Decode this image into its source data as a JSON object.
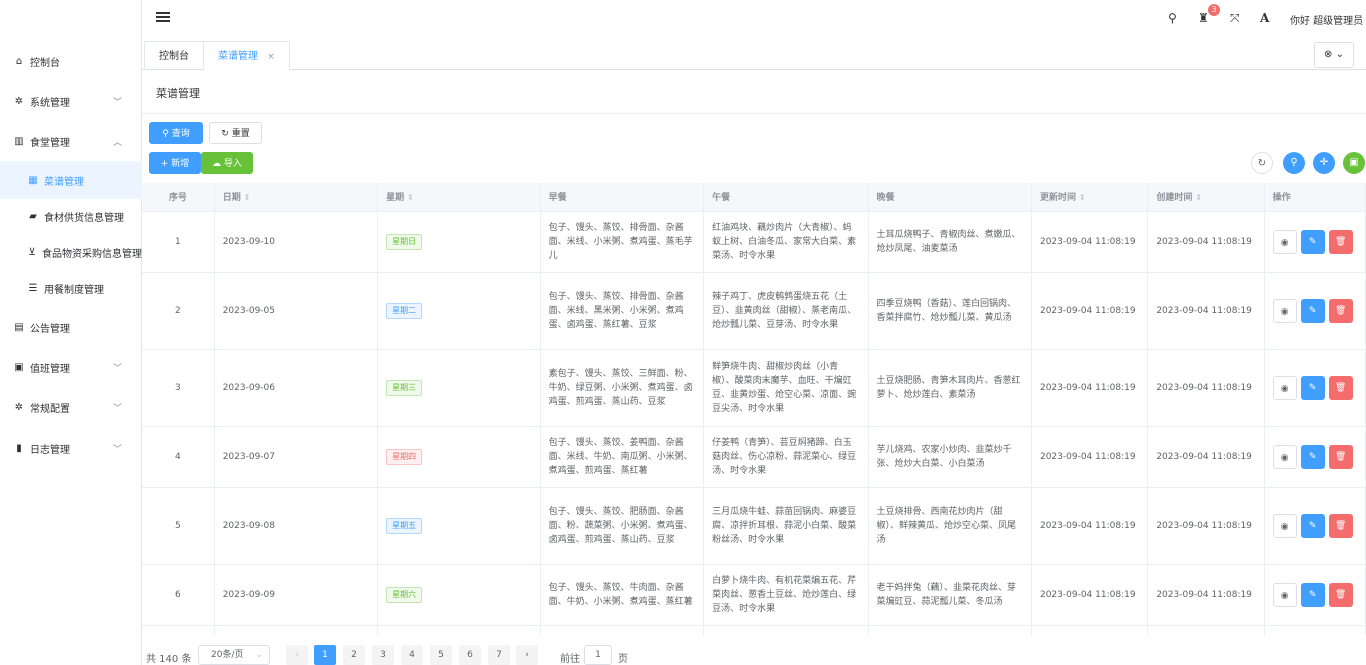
{
  "sidebar": {
    "items": [
      {
        "label": "控制台",
        "icon": "home-icon",
        "glyph": "🏠"
      },
      {
        "label": "系统管理",
        "icon": "gear-icon",
        "glyph": "⚙",
        "arrow": "﹀"
      },
      {
        "label": "食堂管理",
        "icon": "bank-icon",
        "glyph": "🏛",
        "arrow": "︿"
      },
      {
        "label": "菜谱管理",
        "icon": "calendar-icon",
        "glyph": "📅"
      },
      {
        "label": "食材供货信息管理",
        "icon": "truck-icon",
        "glyph": "🚚"
      },
      {
        "label": "食品物资采购信息管理",
        "icon": "cart-icon",
        "glyph": "🛒"
      },
      {
        "label": "用餐制度管理",
        "icon": "list-icon",
        "glyph": "☰"
      },
      {
        "label": "公告管理",
        "icon": "notice-icon",
        "glyph": "▦"
      },
      {
        "label": "值班管理",
        "icon": "id-card-icon",
        "glyph": "▣",
        "arrow": "﹀"
      },
      {
        "label": "常规配置",
        "icon": "cogs-icon",
        "glyph": "⚙",
        "arrow": "﹀"
      },
      {
        "label": "日志管理",
        "icon": "book-icon",
        "glyph": "▤",
        "arrow": "﹀"
      }
    ]
  },
  "header": {
    "notification_count": "3",
    "greeting": "你好 超级管理员",
    "font_glyph": "A"
  },
  "tabs": {
    "items": [
      {
        "label": "控制台"
      },
      {
        "label": "菜谱管理",
        "close": "×"
      }
    ],
    "close_all": "⊗ ⌄"
  },
  "page": {
    "title": "菜谱管理",
    "query_label": "查询",
    "reset_label": "重置",
    "add_label": "新增",
    "import_label": "导入"
  },
  "table": {
    "headers": [
      "序号",
      "日期",
      "星期",
      "早餐",
      "午餐",
      "晚餐",
      "更新时间",
      "创建时间",
      "操作"
    ],
    "rows": [
      {
        "no": "1",
        "date": "2023-09-10",
        "weekday": "星期日",
        "tag": "success",
        "breakfast": "包子、馒头、蒸饺、排骨面、杂酱面、米线、小米粥、煮鸡蛋、蒸毛芋儿",
        "lunch": "红油鸡块、藕炒肉片（大青椒）、蚂蚁上树、白油冬瓜、家常大白菜、素菜汤、时令水果",
        "dinner": "土耳瓜烧鸭子、青椒肉丝、煮嫩瓜、炝炒凤尾、油麦菜汤",
        "updated": "2023-09-04 11:08:19",
        "created": "2023-09-04 11:08:19"
      },
      {
        "no": "2",
        "date": "2023-09-05",
        "weekday": "星期二",
        "tag": "primary",
        "breakfast": "包子、馒头、蒸饺、排骨面、杂酱面、米线、黑米粥、小米粥、煮鸡蛋、卤鸡蛋、蒸红薯、豆浆",
        "lunch": "辣子鸡丁、虎皮鹌鹑蛋烧五花（土豆）、韭黄肉丝（甜椒）、蒸老南瓜、炝炒瓢儿菜、豆芽汤、时令水果",
        "dinner": "四季豆烧鸭（香菇）、莲白回锅肉、香菜拌腐竹、炝炒瓢儿菜、黄瓜汤",
        "updated": "2023-09-04 11:08:19",
        "created": "2023-09-04 11:08:19"
      },
      {
        "no": "3",
        "date": "2023-09-06",
        "weekday": "星期三",
        "tag": "success",
        "breakfast": "素包子、馒头、蒸饺、三鲜面、粉、牛奶、绿豆粥、小米粥、煮鸡蛋、卤鸡蛋、煎鸡蛋、蒸山药、豆浆",
        "lunch": "鲜笋烧牛肉、甜椒炒肉丝（小青椒）、酸菜肉末魔芋、血旺、干煸豇豆、韭黄炒蛋、炝空心菜、凉面、豌豆尖汤、时令水果",
        "dinner": "土豆烧肥肠、青笋木耳肉片、香葱红萝卜、炝炒莲白、素菜汤",
        "updated": "2023-09-04 11:08:19",
        "created": "2023-09-04 11:08:19"
      },
      {
        "no": "4",
        "date": "2023-09-07",
        "weekday": "星期四",
        "tag": "danger",
        "breakfast": "包子、馒头、蒸饺、姜鸭面、杂酱面、米线、牛奶、南瓜粥、小米粥、煮鸡蛋、煎鸡蛋、蒸红薯",
        "lunch": "仔姜鸭（青笋）、芸豆焖猪蹄、白玉菇肉丝、伤心凉粉、蒜泥菜心、绿豆汤、时令水果",
        "dinner": "芋儿烧鸡、农家小炒肉、韭菜炒千张、炝炒大白菜、小白菜汤",
        "updated": "2023-09-04 11:08:19",
        "created": "2023-09-04 11:08:19"
      },
      {
        "no": "5",
        "date": "2023-09-08",
        "weekday": "星期五",
        "tag": "primary",
        "breakfast": "包子、馒头、蒸饺、肥肠面、杂酱面、粉、蔬菜粥、小米粥、煮鸡蛋、卤鸡蛋、煎鸡蛋、蒸山药、豆浆",
        "lunch": "三月瓜烧牛蛙、蒜苗回锅肉、麻婆豆腐、凉拌折耳根、蒜泥小白菜、酸菜粉丝汤、时令水果",
        "dinner": "土豆烧排骨、西南花炒肉片（甜椒）、鲜辣黄瓜、炝炒空心菜、凤尾汤",
        "updated": "2023-09-04 11:08:19",
        "created": "2023-09-04 11:08:19"
      },
      {
        "no": "6",
        "date": "2023-09-09",
        "weekday": "星期六",
        "tag": "success",
        "breakfast": "包子、馒头、蒸饺、牛肉面、杂酱面、牛奶、小米粥、煮鸡蛋、蒸红薯",
        "lunch": "白萝卜烧牛肉、有机花菜煸五花、芹菜肉丝、葱香土豆丝、炝炒莲白、绿豆汤、时令水果",
        "dinner": "老干妈拌兔（藕）、韭菜花肉丝、芽菜煸豇豆、蒜泥瓢儿菜、冬瓜汤",
        "updated": "2023-09-04 11:08:19",
        "created": "2023-09-04 11:08:19"
      },
      {
        "no": "",
        "date": "",
        "weekday": "",
        "tag": "",
        "breakfast": "包子、馒头、蒸饺、牛肉面、杂酱",
        "lunch": "",
        "dinner": "",
        "updated": "",
        "created": ""
      }
    ]
  },
  "pagination": {
    "total": "共 140 条",
    "page_size": "20条/页",
    "pages": [
      "1",
      "2",
      "3",
      "4",
      "5",
      "6",
      "7"
    ],
    "goto_label": "前往",
    "goto_value": "1",
    "goto_suffix": "页"
  }
}
